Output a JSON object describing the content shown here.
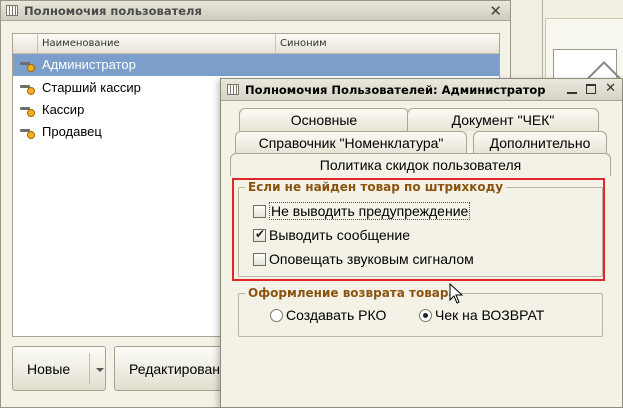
{
  "back_window": {
    "title": "Полномочия пользователя",
    "columns": [
      "Наименование",
      "Синоним"
    ],
    "rows": [
      {
        "name": "Администратор",
        "synonym": "",
        "selected": true
      },
      {
        "name": "Старший кассир",
        "synonym": "",
        "selected": false
      },
      {
        "name": "Кассир",
        "synonym": "",
        "selected": false
      },
      {
        "name": "Продавец",
        "synonym": "",
        "selected": false
      }
    ],
    "buttons": {
      "new": "Новые",
      "edit": "Редактирован"
    }
  },
  "dialog": {
    "title": "Полномочия Пользователей: Администратор",
    "tabs": [
      {
        "label": "Основные",
        "active": false
      },
      {
        "label": "Документ \"ЧЕК\"",
        "active": false
      },
      {
        "label": "Справочник \"Номенклатура\"",
        "active": false
      },
      {
        "label": "Дополнительно",
        "active": false
      },
      {
        "label": "Политика скидок пользователя",
        "active": true
      }
    ],
    "group_barcode": {
      "legend": "Если не найден товар по штрихкоду",
      "options": [
        {
          "label": "Не выводить предупреждение",
          "checked": false
        },
        {
          "label": "Выводить сообщение",
          "checked": true
        },
        {
          "label": "Оповещать звуковым сигналом",
          "checked": false
        }
      ]
    },
    "group_return": {
      "legend": "Оформление возврата товара",
      "options": [
        {
          "label": "Создавать РКО",
          "selected": false
        },
        {
          "label": "Чек на ВОЗВРАТ",
          "selected": true
        }
      ]
    }
  },
  "colors": {
    "selection": "#7b9ecb",
    "highlight_border": "#e0282b",
    "legend_text": "#8a5410"
  }
}
